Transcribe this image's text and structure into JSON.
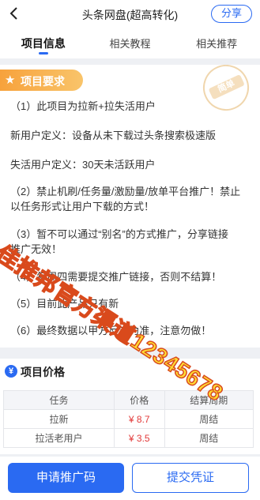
{
  "header": {
    "title": "头条网盘(超高转化)",
    "share_label": "分享"
  },
  "tabs": [
    {
      "label": "项目信息",
      "active": true
    },
    {
      "label": "相关教程",
      "active": false
    },
    {
      "label": "相关推荐",
      "active": false
    }
  ],
  "requirements": {
    "title": "项目要求",
    "stamp": "简单",
    "lines": [
      "（1）此项目为拉新+拉失活用户",
      "新用户定义：设备从未下载过头条搜索极速版",
      "失活用户定义：30天未活跃用户",
      "（2）禁止机刷/任务量/激励量/放单平台推广！禁止",
      "以任务形式让用户下载的方式！",
      "（3）暂不可以通过“别名”的方式推广，分享链接",
      "推广无效！",
      "（4）每周四需要提交推广链接，否则不结算！",
      "（5）目前此产品只有新",
      "（6）最终数据以甲方反馈为准，注意勿做！"
    ]
  },
  "watermark": "佳推邦官方渠道12345678",
  "pricing": {
    "title": "项目价格",
    "columns": [
      "任务",
      "价格",
      "结算周期"
    ],
    "rows": [
      {
        "task": "拉新",
        "price": "¥ 8.7",
        "cycle": "周结"
      },
      {
        "task": "拉活老用户",
        "price": "¥ 3.5",
        "cycle": "周结"
      }
    ]
  },
  "actions": {
    "apply_label": "申请推广码",
    "submit_label": "提交凭证"
  },
  "colors": {
    "accent": "#2a6af2",
    "badge": "#f7a23c",
    "price": "#e23a3a"
  }
}
